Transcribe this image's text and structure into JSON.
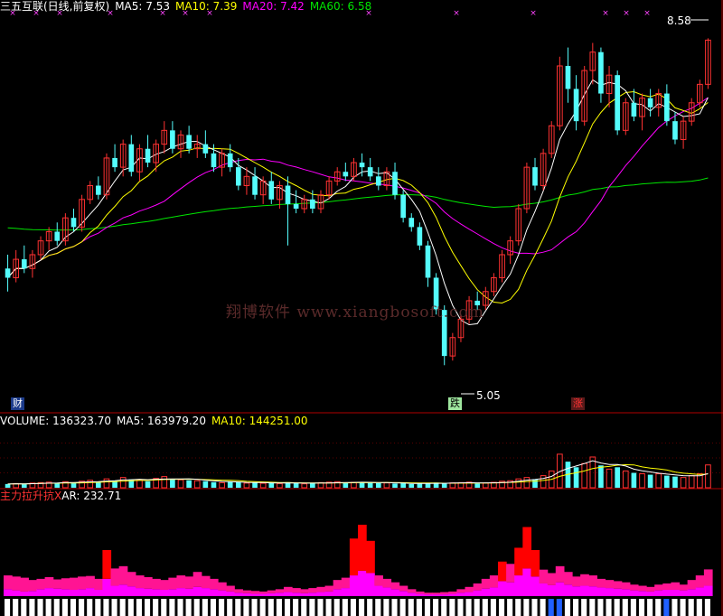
{
  "price_header": {
    "name": "三五互联(日线,前复权)",
    "ma5": "MA5: 7.53",
    "ma10": "MA10: 7.39",
    "ma20": "MA20: 7.42",
    "ma60": "MA60: 6.58"
  },
  "volume_header": {
    "volume": "VOLUME: 136323.70",
    "ma5": "MA5: 163979.20",
    "ma10": "MA10: 144251.00"
  },
  "indicator_header": {
    "name": "主力拉升抗X",
    "ar": "AR: 232.71"
  },
  "annotations": {
    "high_label": "8.58",
    "low_label": "5.05",
    "badge_cai": "财",
    "badge_die": "跌",
    "badge_zhang": "涨"
  },
  "watermark": "翔博软件  www.xiangbosoft.com",
  "colors": {
    "background": "#000000",
    "up_candle": "#ff3232",
    "down_candle": "#54fcfc",
    "ma5": "#ffffff",
    "ma10": "#ffff00",
    "ma20": "#ff00ff",
    "ma60": "#00e600",
    "indicator_red": "#ff0000",
    "indicator_pink": "#ff1493",
    "indicator_magenta": "#ff00ff"
  },
  "chart_data": {
    "type": "candlestick",
    "price_range": [
      4.7,
      8.8
    ],
    "last_close": 8.58,
    "marked_low": 5.05,
    "candles": [
      [
        6.1,
        6.25,
        5.85,
        6.0
      ],
      [
        6.0,
        6.3,
        5.95,
        6.2
      ],
      [
        6.2,
        6.35,
        6.05,
        6.1
      ],
      [
        6.1,
        6.3,
        6.0,
        6.25
      ],
      [
        6.25,
        6.45,
        6.2,
        6.4
      ],
      [
        6.4,
        6.55,
        6.3,
        6.5
      ],
      [
        6.5,
        6.6,
        6.35,
        6.4
      ],
      [
        6.4,
        6.7,
        6.35,
        6.65
      ],
      [
        6.65,
        6.75,
        6.5,
        6.55
      ],
      [
        6.55,
        6.9,
        6.5,
        6.85
      ],
      [
        6.85,
        7.05,
        6.8,
        7.0
      ],
      [
        7.0,
        7.1,
        6.85,
        6.9
      ],
      [
        6.9,
        7.35,
        6.85,
        7.3
      ],
      [
        7.3,
        7.45,
        7.15,
        7.2
      ],
      [
        7.2,
        7.5,
        7.1,
        7.45
      ],
      [
        7.45,
        7.55,
        7.1,
        7.15
      ],
      [
        7.15,
        7.45,
        7.05,
        7.4
      ],
      [
        7.4,
        7.55,
        7.2,
        7.25
      ],
      [
        7.25,
        7.5,
        7.15,
        7.45
      ],
      [
        7.45,
        7.7,
        7.35,
        7.6
      ],
      [
        7.6,
        7.7,
        7.35,
        7.4
      ],
      [
        7.4,
        7.6,
        7.3,
        7.55
      ],
      [
        7.55,
        7.65,
        7.35,
        7.4
      ],
      [
        7.4,
        7.55,
        7.3,
        7.45
      ],
      [
        7.45,
        7.6,
        7.3,
        7.35
      ],
      [
        7.35,
        7.45,
        7.15,
        7.2
      ],
      [
        7.2,
        7.4,
        7.1,
        7.35
      ],
      [
        7.35,
        7.45,
        7.15,
        7.2
      ],
      [
        7.2,
        7.3,
        6.95,
        7.0
      ],
      [
        7.0,
        7.2,
        6.9,
        7.1
      ],
      [
        7.1,
        7.2,
        6.85,
        6.9
      ],
      [
        6.9,
        7.1,
        6.8,
        7.05
      ],
      [
        7.05,
        7.15,
        6.8,
        6.85
      ],
      [
        6.85,
        7.05,
        6.75,
        7.0
      ],
      [
        7.0,
        7.1,
        6.35,
        6.8
      ],
      [
        6.8,
        6.95,
        6.7,
        6.75
      ],
      [
        6.75,
        6.9,
        6.7,
        6.85
      ],
      [
        6.85,
        6.95,
        6.7,
        6.75
      ],
      [
        6.75,
        6.95,
        6.7,
        6.9
      ],
      [
        6.9,
        7.1,
        6.85,
        7.05
      ],
      [
        7.05,
        7.2,
        7.0,
        7.15
      ],
      [
        7.15,
        7.25,
        7.05,
        7.1
      ],
      [
        7.1,
        7.3,
        7.05,
        7.25
      ],
      [
        7.25,
        7.35,
        7.1,
        7.2
      ],
      [
        7.2,
        7.3,
        7.05,
        7.1
      ],
      [
        7.1,
        7.2,
        6.95,
        7.0
      ],
      [
        7.0,
        7.2,
        6.95,
        7.15
      ],
      [
        7.15,
        7.25,
        6.85,
        6.9
      ],
      [
        6.9,
        6.95,
        6.6,
        6.65
      ],
      [
        6.65,
        6.7,
        6.5,
        6.55
      ],
      [
        6.55,
        6.6,
        6.3,
        6.35
      ],
      [
        6.35,
        6.4,
        5.9,
        6.0
      ],
      [
        6.0,
        6.05,
        5.6,
        5.65
      ],
      [
        5.65,
        5.7,
        5.05,
        5.15
      ],
      [
        5.15,
        5.4,
        5.1,
        5.35
      ],
      [
        5.35,
        5.6,
        5.3,
        5.55
      ],
      [
        5.55,
        5.8,
        5.5,
        5.75
      ],
      [
        5.75,
        5.85,
        5.65,
        5.7
      ],
      [
        5.7,
        5.9,
        5.65,
        5.85
      ],
      [
        5.85,
        6.05,
        5.8,
        6.0
      ],
      [
        6.0,
        6.3,
        5.95,
        6.25
      ],
      [
        6.25,
        6.45,
        6.15,
        6.4
      ],
      [
        6.4,
        6.8,
        6.35,
        6.75
      ],
      [
        6.75,
        7.25,
        6.7,
        7.2
      ],
      [
        7.2,
        7.3,
        6.95,
        7.0
      ],
      [
        7.0,
        7.4,
        6.95,
        7.35
      ],
      [
        7.35,
        7.7,
        7.3,
        7.65
      ],
      [
        7.65,
        8.4,
        7.6,
        8.3
      ],
      [
        8.3,
        8.5,
        7.9,
        8.05
      ],
      [
        8.05,
        8.2,
        7.6,
        7.7
      ],
      [
        7.7,
        8.3,
        7.65,
        8.25
      ],
      [
        8.25,
        8.55,
        8.1,
        8.45
      ],
      [
        8.45,
        8.5,
        7.9,
        8.0
      ],
      [
        8.0,
        8.3,
        7.85,
        8.2
      ],
      [
        8.2,
        8.25,
        7.55,
        7.6
      ],
      [
        7.6,
        7.95,
        7.55,
        7.9
      ],
      [
        7.9,
        8.05,
        7.7,
        7.75
      ],
      [
        7.75,
        8.0,
        7.6,
        7.95
      ],
      [
        7.95,
        8.05,
        7.75,
        7.85
      ],
      [
        7.85,
        8.05,
        7.75,
        8.0
      ],
      [
        8.0,
        8.1,
        7.65,
        7.7
      ],
      [
        7.7,
        7.8,
        7.45,
        7.5
      ],
      [
        7.5,
        7.75,
        7.4,
        7.7
      ],
      [
        7.7,
        7.95,
        7.65,
        7.9
      ],
      [
        7.9,
        8.15,
        7.85,
        8.1
      ],
      [
        8.1,
        8.6,
        8.05,
        8.58
      ]
    ],
    "volume_range": [
      0,
      640000
    ],
    "volume": [
      40,
      45,
      38,
      50,
      55,
      60,
      48,
      65,
      52,
      70,
      80,
      60,
      95,
      75,
      110,
      90,
      85,
      70,
      100,
      120,
      95,
      85,
      80,
      75,
      70,
      60,
      55,
      65,
      58,
      50,
      55,
      48,
      52,
      45,
      60,
      50,
      42,
      48,
      55,
      60,
      65,
      50,
      58,
      62,
      55,
      50,
      52,
      45,
      48,
      40,
      45,
      50,
      55,
      48,
      52,
      55,
      60,
      45,
      50,
      58,
      70,
      75,
      95,
      110,
      90,
      130,
      180,
      360,
      280,
      220,
      260,
      330,
      240,
      200,
      220,
      180,
      160,
      150,
      140,
      150,
      130,
      120,
      110,
      130,
      150,
      245
    ],
    "indicator_range": [
      0,
      800
    ],
    "indicator": [
      [
        0,
        180,
        60
      ],
      [
        0,
        170,
        50
      ],
      [
        0,
        160,
        40
      ],
      [
        0,
        140,
        45
      ],
      [
        0,
        150,
        60
      ],
      [
        0,
        165,
        70
      ],
      [
        0,
        145,
        65
      ],
      [
        0,
        155,
        60
      ],
      [
        0,
        160,
        55
      ],
      [
        0,
        170,
        60
      ],
      [
        0,
        175,
        70
      ],
      [
        0,
        150,
        55
      ],
      [
        400,
        0,
        150
      ],
      [
        0,
        240,
        90
      ],
      [
        0,
        260,
        100
      ],
      [
        0,
        210,
        85
      ],
      [
        0,
        180,
        70
      ],
      [
        0,
        165,
        65
      ],
      [
        0,
        150,
        60
      ],
      [
        0,
        140,
        55
      ],
      [
        0,
        160,
        60
      ],
      [
        0,
        180,
        70
      ],
      [
        0,
        170,
        65
      ],
      [
        0,
        210,
        80
      ],
      [
        0,
        175,
        70
      ],
      [
        0,
        150,
        60
      ],
      [
        0,
        120,
        50
      ],
      [
        0,
        90,
        40
      ],
      [
        0,
        60,
        30
      ],
      [
        0,
        50,
        25
      ],
      [
        0,
        45,
        20
      ],
      [
        0,
        40,
        20
      ],
      [
        0,
        50,
        25
      ],
      [
        0,
        60,
        30
      ],
      [
        0,
        80,
        35
      ],
      [
        0,
        70,
        30
      ],
      [
        0,
        60,
        25
      ],
      [
        0,
        70,
        30
      ],
      [
        0,
        80,
        35
      ],
      [
        0,
        90,
        40
      ],
      [
        0,
        140,
        60
      ],
      [
        0,
        160,
        70
      ],
      [
        500,
        0,
        180
      ],
      [
        620,
        0,
        220
      ],
      [
        480,
        0,
        200
      ],
      [
        0,
        180,
        90
      ],
      [
        0,
        150,
        75
      ],
      [
        0,
        120,
        60
      ],
      [
        0,
        90,
        45
      ],
      [
        0,
        60,
        30
      ],
      [
        0,
        40,
        20
      ],
      [
        0,
        30,
        15
      ],
      [
        0,
        30,
        15
      ],
      [
        0,
        35,
        15
      ],
      [
        0,
        40,
        20
      ],
      [
        0,
        60,
        30
      ],
      [
        0,
        80,
        35
      ],
      [
        0,
        110,
        50
      ],
      [
        0,
        150,
        65
      ],
      [
        0,
        180,
        75
      ],
      [
        300,
        0,
        130
      ],
      [
        0,
        280,
        120
      ],
      [
        420,
        0,
        180
      ],
      [
        600,
        0,
        240
      ],
      [
        400,
        0,
        170
      ],
      [
        0,
        230,
        110
      ],
      [
        0,
        200,
        95
      ],
      [
        0,
        260,
        120
      ],
      [
        0,
        210,
        100
      ],
      [
        0,
        170,
        85
      ],
      [
        0,
        190,
        90
      ],
      [
        0,
        180,
        85
      ],
      [
        0,
        150,
        75
      ],
      [
        0,
        140,
        70
      ],
      [
        0,
        130,
        65
      ],
      [
        0,
        120,
        60
      ],
      [
        0,
        100,
        50
      ],
      [
        0,
        90,
        45
      ],
      [
        0,
        80,
        40
      ],
      [
        0,
        100,
        50
      ],
      [
        0,
        110,
        55
      ],
      [
        0,
        120,
        55
      ],
      [
        0,
        100,
        50
      ],
      [
        0,
        140,
        60
      ],
      [
        0,
        180,
        75
      ],
      [
        0,
        232,
        90
      ]
    ]
  }
}
